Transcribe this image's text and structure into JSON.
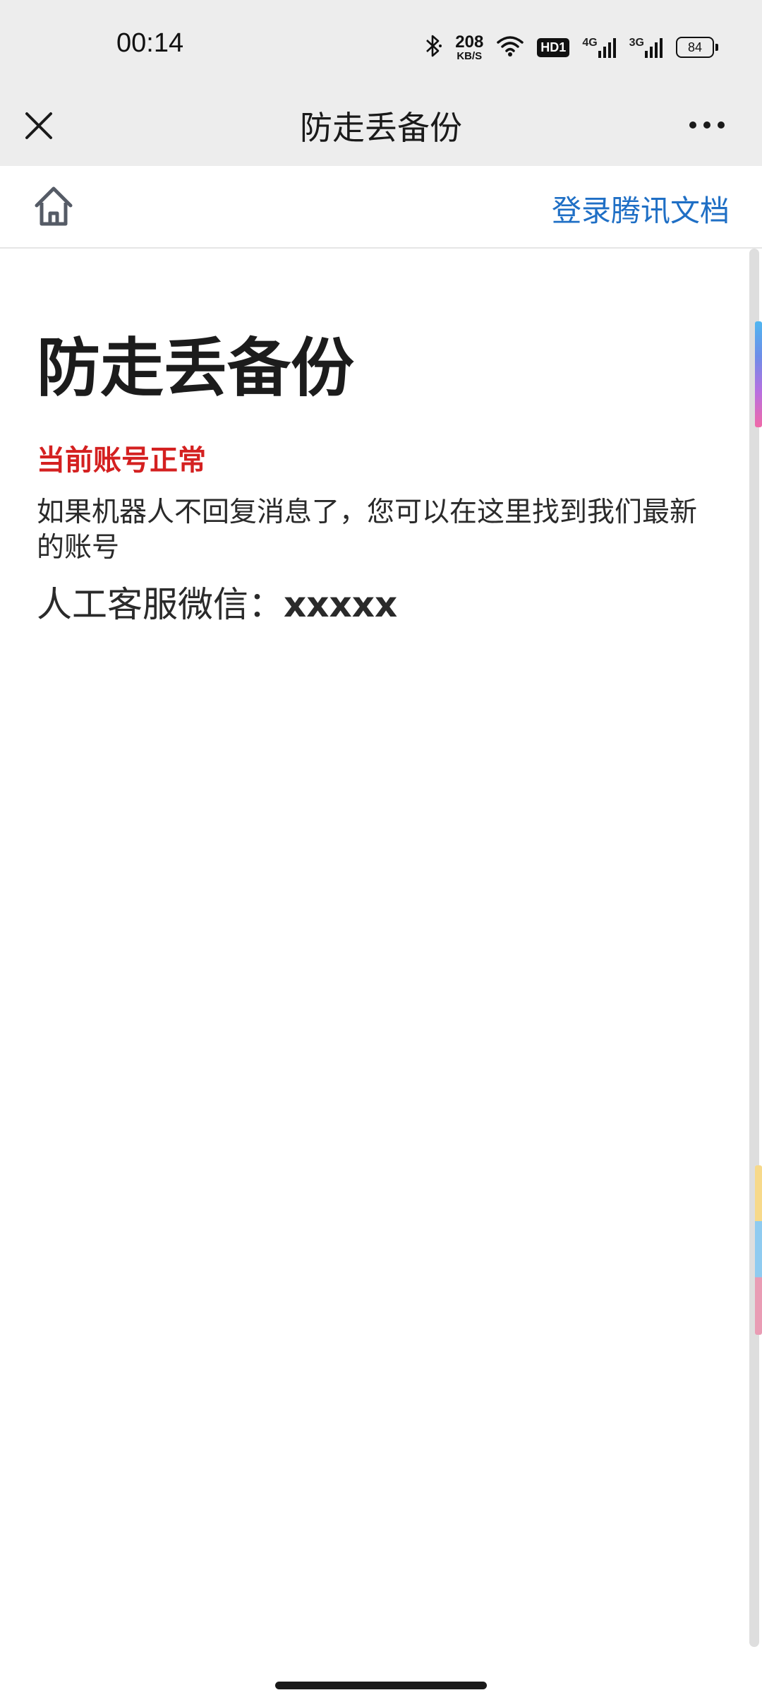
{
  "status_bar": {
    "time": "00:14",
    "speed_value": "208",
    "speed_unit": "KB/S",
    "hd_label": "HD1",
    "net1_label": "4G",
    "net2_label": "3G",
    "battery_level": "84",
    "icons": [
      "bluetooth-icon",
      "wifi-icon",
      "signal-icon",
      "battery-icon"
    ]
  },
  "nav": {
    "title": "防走丢备份",
    "close_icon": "close-icon",
    "more_icon": "more-icon"
  },
  "toolbar": {
    "home_icon": "home-icon",
    "login_label": "登录腾讯文档"
  },
  "doc": {
    "title": "防走丢备份",
    "status_text": "当前账号正常",
    "info_text": "如果机器人不回复消息了，您可以在这里找到我们最新的账号",
    "contact_label": "人工客服微信：",
    "contact_value": "xxxxx"
  },
  "colors": {
    "status_red": "#d42020",
    "link_blue": "#1f6fc5",
    "bar_gray": "#ededed"
  }
}
